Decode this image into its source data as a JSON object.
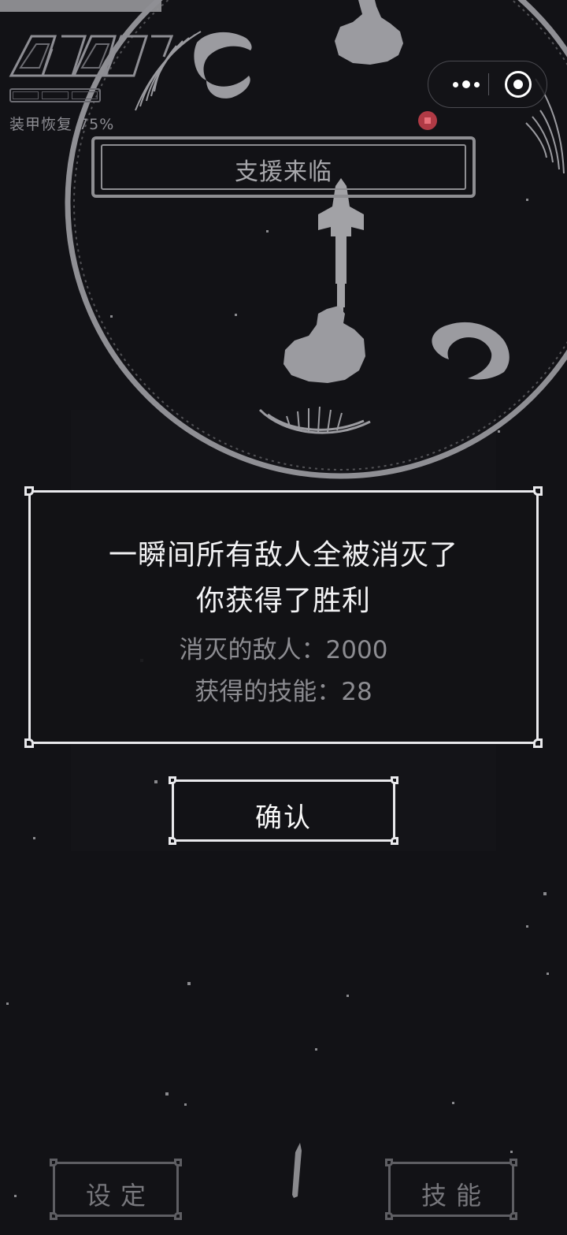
{
  "hud": {
    "armor_label": "装甲恢复",
    "armor_percent": "75%",
    "armor_value": 0.75
  },
  "capsule": {
    "more_icon": "more-dots-icon",
    "close_icon": "target-close-icon"
  },
  "banner": {
    "text": "支援来临"
  },
  "dialog": {
    "line1": "一瞬间所有敌人全被消灭了",
    "line2": "你获得了胜利",
    "enemies_label": "消灭的敌人：",
    "enemies_value": "2000",
    "skills_label": "获得的技能：",
    "skills_value": "28"
  },
  "confirm": {
    "label": "确认"
  },
  "bottom": {
    "settings_label": "设定",
    "skills_label": "技能"
  },
  "colors": {
    "background": "#121216",
    "frame": "#e9e9ec",
    "muted": "#8c8c91",
    "planet": "#9b9ba0",
    "alert": "#b03a45"
  }
}
